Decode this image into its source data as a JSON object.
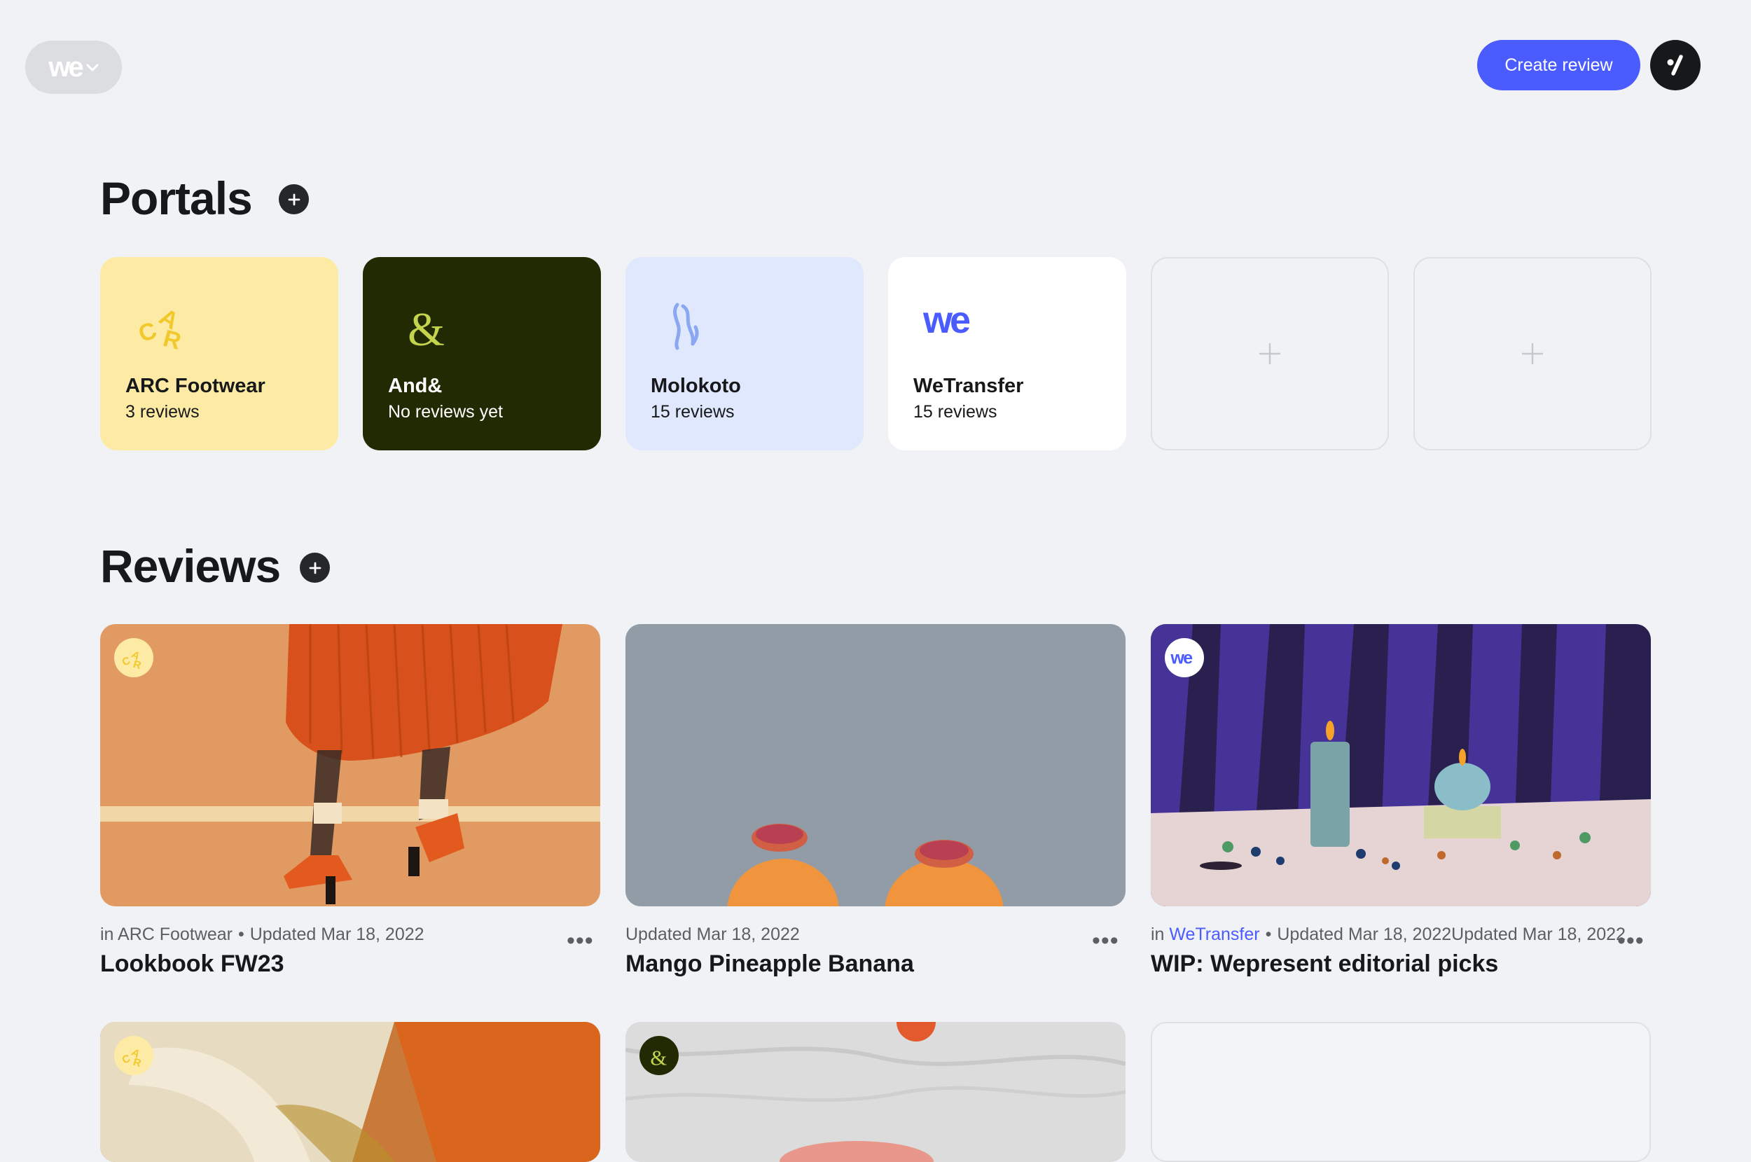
{
  "header": {
    "logo_text": "we",
    "logo_chevron": "⌄",
    "create_button_label": "Create review",
    "account_icon": "avatar-slash-icon"
  },
  "portals_section": {
    "title": "Portals",
    "add_icon": "plus-circle-icon",
    "items": [
      {
        "name": "ARC Footwear",
        "count": "3 reviews",
        "bg": "#fdeba5",
        "text_color": "#17181a",
        "icon": "arc-logo-icon"
      },
      {
        "name": "And&",
        "count": "No reviews yet",
        "bg": "#222a04",
        "text_color": "#ffffff",
        "icon": "ampersand-icon"
      },
      {
        "name": "Molokoto",
        "count": "15 reviews",
        "bg": "#dfe8fd",
        "text_color": "#17181a",
        "icon": "molokoto-logo-icon"
      },
      {
        "name": "WeTransfer",
        "count": "15 reviews",
        "bg": "#ffffff",
        "text_color": "#17181a",
        "icon": "wetransfer-logo-icon"
      }
    ],
    "empty_slots": 2
  },
  "reviews_section": {
    "title": "Reviews",
    "add_icon": "plus-circle-icon",
    "items": [
      {
        "portal_prefix": "in ",
        "portal": "ARC Footwear",
        "separator": "•",
        "updated": "Updated Mar 18, 2022",
        "title": "Lookbook FW23",
        "more": "•••",
        "badge": "arc-logo-icon"
      },
      {
        "updated": "Updated Mar 18, 2022",
        "title": "Mango Pineapple Banana",
        "more": "•••"
      },
      {
        "portal_prefix": "in ",
        "portal": "WeTransfer",
        "separator": "•",
        "updated": "Updated Mar 18, 2022Updated Mar 18, 2022",
        "title": "WIP: Wepresent editorial picks",
        "more": "•••",
        "badge": "wetransfer-logo-icon"
      }
    ],
    "second_row_badges": [
      "arc-logo-icon",
      "ampersand-icon"
    ]
  },
  "colors": {
    "accent": "#4b5cff",
    "background": "#f1f2f5",
    "arc_yellow": "#fdeba5",
    "and_dark_green": "#222a04",
    "molokoto_blue": "#dfe8fd"
  }
}
